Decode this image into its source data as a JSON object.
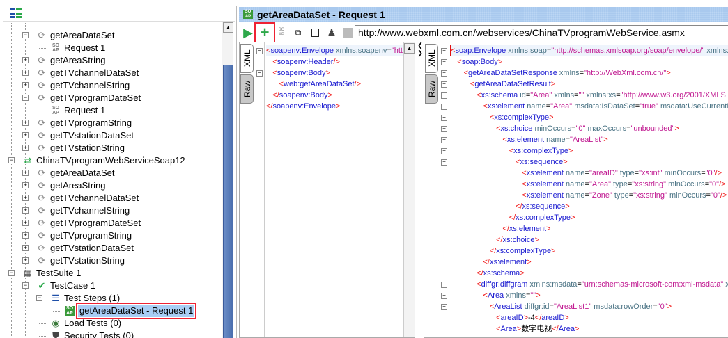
{
  "navigator": {
    "rows": [
      {
        "label": "getAreaDataSet",
        "icon": "operation-icon",
        "level": 3,
        "exp": "-"
      },
      {
        "label": "Request 1",
        "icon": "soap-request-icon",
        "level": 4
      },
      {
        "label": "getAreaString",
        "icon": "operation-icon",
        "level": 3,
        "exp": "+"
      },
      {
        "label": "getTVchannelDataSet",
        "icon": "operation-icon",
        "level": 3,
        "exp": "+"
      },
      {
        "label": "getTVchannelString",
        "icon": "operation-icon",
        "level": 3,
        "exp": "+"
      },
      {
        "label": "getTVprogramDateSet",
        "icon": "operation-icon",
        "level": 3,
        "exp": "-"
      },
      {
        "label": "Request 1",
        "icon": "soap-request-icon",
        "level": 4
      },
      {
        "label": "getTVprogramString",
        "icon": "operation-icon",
        "level": 3,
        "exp": "+"
      },
      {
        "label": "getTVstationDataSet",
        "icon": "operation-icon",
        "level": 3,
        "exp": "+"
      },
      {
        "label": "getTVstationString",
        "icon": "operation-icon",
        "level": 3,
        "exp": "+"
      },
      {
        "label": "ChinaTVprogramWebServiceSoap12",
        "icon": "interface-icon",
        "level": 2,
        "exp": "-"
      },
      {
        "label": "getAreaDataSet",
        "icon": "operation-icon",
        "level": 3,
        "exp": "+"
      },
      {
        "label": "getAreaString",
        "icon": "operation-icon",
        "level": 3,
        "exp": "+"
      },
      {
        "label": "getTVchannelDataSet",
        "icon": "operation-icon",
        "level": 3,
        "exp": "+"
      },
      {
        "label": "getTVchannelString",
        "icon": "operation-icon",
        "level": 3,
        "exp": "+"
      },
      {
        "label": "getTVprogramDateSet",
        "icon": "operation-icon",
        "level": 3,
        "exp": "+"
      },
      {
        "label": "getTVprogramString",
        "icon": "operation-icon",
        "level": 3,
        "exp": "+"
      },
      {
        "label": "getTVstationDataSet",
        "icon": "operation-icon",
        "level": 3,
        "exp": "+"
      },
      {
        "label": "getTVstationString",
        "icon": "operation-icon",
        "level": 3,
        "exp": "+"
      },
      {
        "label": "TestSuite 1",
        "icon": "testsuite-icon",
        "level": 2,
        "exp": "-"
      },
      {
        "label": "TestCase 1",
        "icon": "testcase-check-icon",
        "level": 3,
        "exp": "-"
      },
      {
        "label": "Test Steps (1)",
        "icon": "test-steps-icon",
        "level": 4,
        "exp": "-"
      },
      {
        "label": "getAreaDataSet - Request 1",
        "icon": "soap-request-icon",
        "level": 5,
        "selected": true
      },
      {
        "label": "Load Tests (0)",
        "icon": "load-test-icon",
        "level": 4
      },
      {
        "label": "Security Tests (0)",
        "icon": "security-shield-icon",
        "level": 4
      }
    ]
  },
  "editor": {
    "title": "getAreaDataSet - Request 1",
    "url": "http://www.webxml.com.cn/webservices/ChinaTVprogramWebService.asmx",
    "tabs": {
      "xml": "XML",
      "raw": "Raw"
    },
    "toolbar": [
      "run-icon",
      "add-assertion-icon",
      "soap-icon",
      "wsdl-icon",
      "stop-icon",
      "user-icon",
      "square-icon"
    ],
    "request": [
      {
        "d": 0,
        "f": true,
        "tk": [
          [
            "b",
            "<"
          ],
          [
            "t",
            "soapenv:Envelope "
          ],
          [
            "a",
            "xmlns:soapenv"
          ],
          [
            "x",
            "="
          ],
          [
            "v",
            "\"http"
          ]
        ]
      },
      {
        "d": 1,
        "tk": [
          [
            "b",
            "<"
          ],
          [
            "t",
            "soapenv:Header"
          ],
          [
            "b",
            "/>"
          ]
        ]
      },
      {
        "d": 1,
        "f": true,
        "tk": [
          [
            "b",
            "<"
          ],
          [
            "t",
            "soapenv:Body"
          ],
          [
            "b",
            ">"
          ]
        ]
      },
      {
        "d": 2,
        "tk": [
          [
            "b",
            "<"
          ],
          [
            "t",
            "web:getAreaDataSet"
          ],
          [
            "b",
            "/>"
          ]
        ]
      },
      {
        "d": 1,
        "tk": [
          [
            "b",
            "</"
          ],
          [
            "t",
            "soapenv:Body"
          ],
          [
            "b",
            ">"
          ]
        ]
      },
      {
        "d": 0,
        "tk": [
          [
            "b",
            "</"
          ],
          [
            "t",
            "soapenv:Envelope"
          ],
          [
            "b",
            ">"
          ]
        ]
      }
    ],
    "response": [
      {
        "d": 0,
        "f": true,
        "tk": [
          [
            "b",
            "<"
          ],
          [
            "t",
            "soap:Envelope "
          ],
          [
            "a",
            "xmlns:soap"
          ],
          [
            "x",
            "="
          ],
          [
            "v",
            "\"http://schemas.xmlsoap.org/soap/envelope/\""
          ],
          [
            "a",
            " xmlns:x"
          ]
        ]
      },
      {
        "d": 1,
        "f": true,
        "tk": [
          [
            "b",
            "<"
          ],
          [
            "t",
            "soap:Body"
          ],
          [
            "b",
            ">"
          ]
        ]
      },
      {
        "d": 2,
        "f": true,
        "tk": [
          [
            "b",
            "<"
          ],
          [
            "t",
            "getAreaDataSetResponse "
          ],
          [
            "a",
            "xmlns"
          ],
          [
            "x",
            "="
          ],
          [
            "v",
            "\"http://WebXml.com.cn/\""
          ],
          [
            "b",
            ">"
          ]
        ]
      },
      {
        "d": 3,
        "f": true,
        "tk": [
          [
            "b",
            "<"
          ],
          [
            "t",
            "getAreaDataSetResult"
          ],
          [
            "b",
            ">"
          ]
        ]
      },
      {
        "d": 4,
        "f": true,
        "tk": [
          [
            "b",
            "<"
          ],
          [
            "t",
            "xs:schema "
          ],
          [
            "a",
            "id"
          ],
          [
            "x",
            "="
          ],
          [
            "v",
            "\"Area\""
          ],
          [
            "a",
            " xmlns"
          ],
          [
            "x",
            "="
          ],
          [
            "v",
            "\"\""
          ],
          [
            "a",
            " xmlns:xs"
          ],
          [
            "x",
            "="
          ],
          [
            "v",
            "\"http://www.w3.org/2001/XMLS"
          ]
        ]
      },
      {
        "d": 5,
        "f": true,
        "tk": [
          [
            "b",
            "<"
          ],
          [
            "t",
            "xs:element "
          ],
          [
            "a",
            "name"
          ],
          [
            "x",
            "="
          ],
          [
            "v",
            "\"Area\""
          ],
          [
            "a",
            " msdata:IsDataSet"
          ],
          [
            "x",
            "="
          ],
          [
            "v",
            "\"true\""
          ],
          [
            "a",
            " msdata:UseCurrentLo"
          ]
        ]
      },
      {
        "d": 6,
        "f": true,
        "tk": [
          [
            "b",
            "<"
          ],
          [
            "t",
            "xs:complexType"
          ],
          [
            "b",
            ">"
          ]
        ]
      },
      {
        "d": 7,
        "f": true,
        "tk": [
          [
            "b",
            "<"
          ],
          [
            "t",
            "xs:choice "
          ],
          [
            "a",
            "minOccurs"
          ],
          [
            "x",
            "="
          ],
          [
            "v",
            "\"0\""
          ],
          [
            "a",
            " maxOccurs"
          ],
          [
            "x",
            "="
          ],
          [
            "v",
            "\"unbounded\""
          ],
          [
            "b",
            ">"
          ]
        ]
      },
      {
        "d": 8,
        "f": true,
        "tk": [
          [
            "b",
            "<"
          ],
          [
            "t",
            "xs:element "
          ],
          [
            "a",
            "name"
          ],
          [
            "x",
            "="
          ],
          [
            "v",
            "\"AreaList\""
          ],
          [
            "b",
            ">"
          ]
        ]
      },
      {
        "d": 9,
        "f": true,
        "tk": [
          [
            "b",
            "<"
          ],
          [
            "t",
            "xs:complexType"
          ],
          [
            "b",
            ">"
          ]
        ]
      },
      {
        "d": 10,
        "f": true,
        "tk": [
          [
            "b",
            "<"
          ],
          [
            "t",
            "xs:sequence"
          ],
          [
            "b",
            ">"
          ]
        ]
      },
      {
        "d": 11,
        "tk": [
          [
            "b",
            "<"
          ],
          [
            "t",
            "xs:element "
          ],
          [
            "a",
            "name"
          ],
          [
            "x",
            "="
          ],
          [
            "v",
            "\"areaID\""
          ],
          [
            "a",
            " type"
          ],
          [
            "x",
            "="
          ],
          [
            "v",
            "\"xs:int\""
          ],
          [
            "a",
            " minOccurs"
          ],
          [
            "x",
            "="
          ],
          [
            "v",
            "\"0\""
          ],
          [
            "b",
            "/>"
          ]
        ]
      },
      {
        "d": 11,
        "tk": [
          [
            "b",
            "<"
          ],
          [
            "t",
            "xs:element "
          ],
          [
            "a",
            "name"
          ],
          [
            "x",
            "="
          ],
          [
            "v",
            "\"Area\""
          ],
          [
            "a",
            " type"
          ],
          [
            "x",
            "="
          ],
          [
            "v",
            "\"xs:string\""
          ],
          [
            "a",
            " minOccurs"
          ],
          [
            "x",
            "="
          ],
          [
            "v",
            "\"0\""
          ],
          [
            "b",
            "/>"
          ]
        ]
      },
      {
        "d": 11,
        "tk": [
          [
            "b",
            "<"
          ],
          [
            "t",
            "xs:element "
          ],
          [
            "a",
            "name"
          ],
          [
            "x",
            "="
          ],
          [
            "v",
            "\"Zone\""
          ],
          [
            "a",
            " type"
          ],
          [
            "x",
            "="
          ],
          [
            "v",
            "\"xs:string\""
          ],
          [
            "a",
            " minOccurs"
          ],
          [
            "x",
            "="
          ],
          [
            "v",
            "\"0\""
          ],
          [
            "b",
            "/>"
          ]
        ]
      },
      {
        "d": 10,
        "tk": [
          [
            "b",
            "</"
          ],
          [
            "t",
            "xs:sequence"
          ],
          [
            "b",
            ">"
          ]
        ]
      },
      {
        "d": 9,
        "tk": [
          [
            "b",
            "</"
          ],
          [
            "t",
            "xs:complexType"
          ],
          [
            "b",
            ">"
          ]
        ]
      },
      {
        "d": 8,
        "tk": [
          [
            "b",
            "</"
          ],
          [
            "t",
            "xs:element"
          ],
          [
            "b",
            ">"
          ]
        ]
      },
      {
        "d": 7,
        "tk": [
          [
            "b",
            "</"
          ],
          [
            "t",
            "xs:choice"
          ],
          [
            "b",
            ">"
          ]
        ]
      },
      {
        "d": 6,
        "tk": [
          [
            "b",
            "</"
          ],
          [
            "t",
            "xs:complexType"
          ],
          [
            "b",
            ">"
          ]
        ]
      },
      {
        "d": 5,
        "tk": [
          [
            "b",
            "</"
          ],
          [
            "t",
            "xs:element"
          ],
          [
            "b",
            ">"
          ]
        ]
      },
      {
        "d": 4,
        "tk": [
          [
            "b",
            "</"
          ],
          [
            "t",
            "xs:schema"
          ],
          [
            "b",
            ">"
          ]
        ]
      },
      {
        "d": 4,
        "f": true,
        "tk": [
          [
            "b",
            "<"
          ],
          [
            "t",
            "diffgr:diffgram "
          ],
          [
            "a",
            "xmlns:msdata"
          ],
          [
            "x",
            "="
          ],
          [
            "v",
            "\"urn:schemas-microsoft-com:xml-msdata\""
          ],
          [
            "a",
            " x"
          ]
        ]
      },
      {
        "d": 5,
        "f": true,
        "tk": [
          [
            "b",
            "<"
          ],
          [
            "t",
            "Area "
          ],
          [
            "a",
            "xmlns"
          ],
          [
            "x",
            "="
          ],
          [
            "v",
            "\"\""
          ],
          [
            "b",
            ">"
          ]
        ]
      },
      {
        "d": 6,
        "f": true,
        "tk": [
          [
            "b",
            "<"
          ],
          [
            "t",
            "AreaList "
          ],
          [
            "a",
            "diffgr:id"
          ],
          [
            "x",
            "="
          ],
          [
            "v",
            "\"AreaList1\""
          ],
          [
            "a",
            " msdata:rowOrder"
          ],
          [
            "x",
            "="
          ],
          [
            "v",
            "\"0\""
          ],
          [
            "b",
            ">"
          ]
        ]
      },
      {
        "d": 7,
        "tk": [
          [
            "b",
            "<"
          ],
          [
            "t",
            "areaID"
          ],
          [
            "b",
            ">"
          ],
          [
            "x",
            "-4"
          ],
          [
            "b",
            "</"
          ],
          [
            "t",
            "areaID"
          ],
          [
            "b",
            ">"
          ]
        ]
      },
      {
        "d": 7,
        "tk": [
          [
            "b",
            "<"
          ],
          [
            "t",
            "Area"
          ],
          [
            "b",
            ">"
          ],
          [
            "x",
            "数字电视"
          ],
          [
            "b",
            "</"
          ],
          [
            "t",
            "Area"
          ],
          [
            "b",
            ">"
          ]
        ]
      }
    ]
  }
}
